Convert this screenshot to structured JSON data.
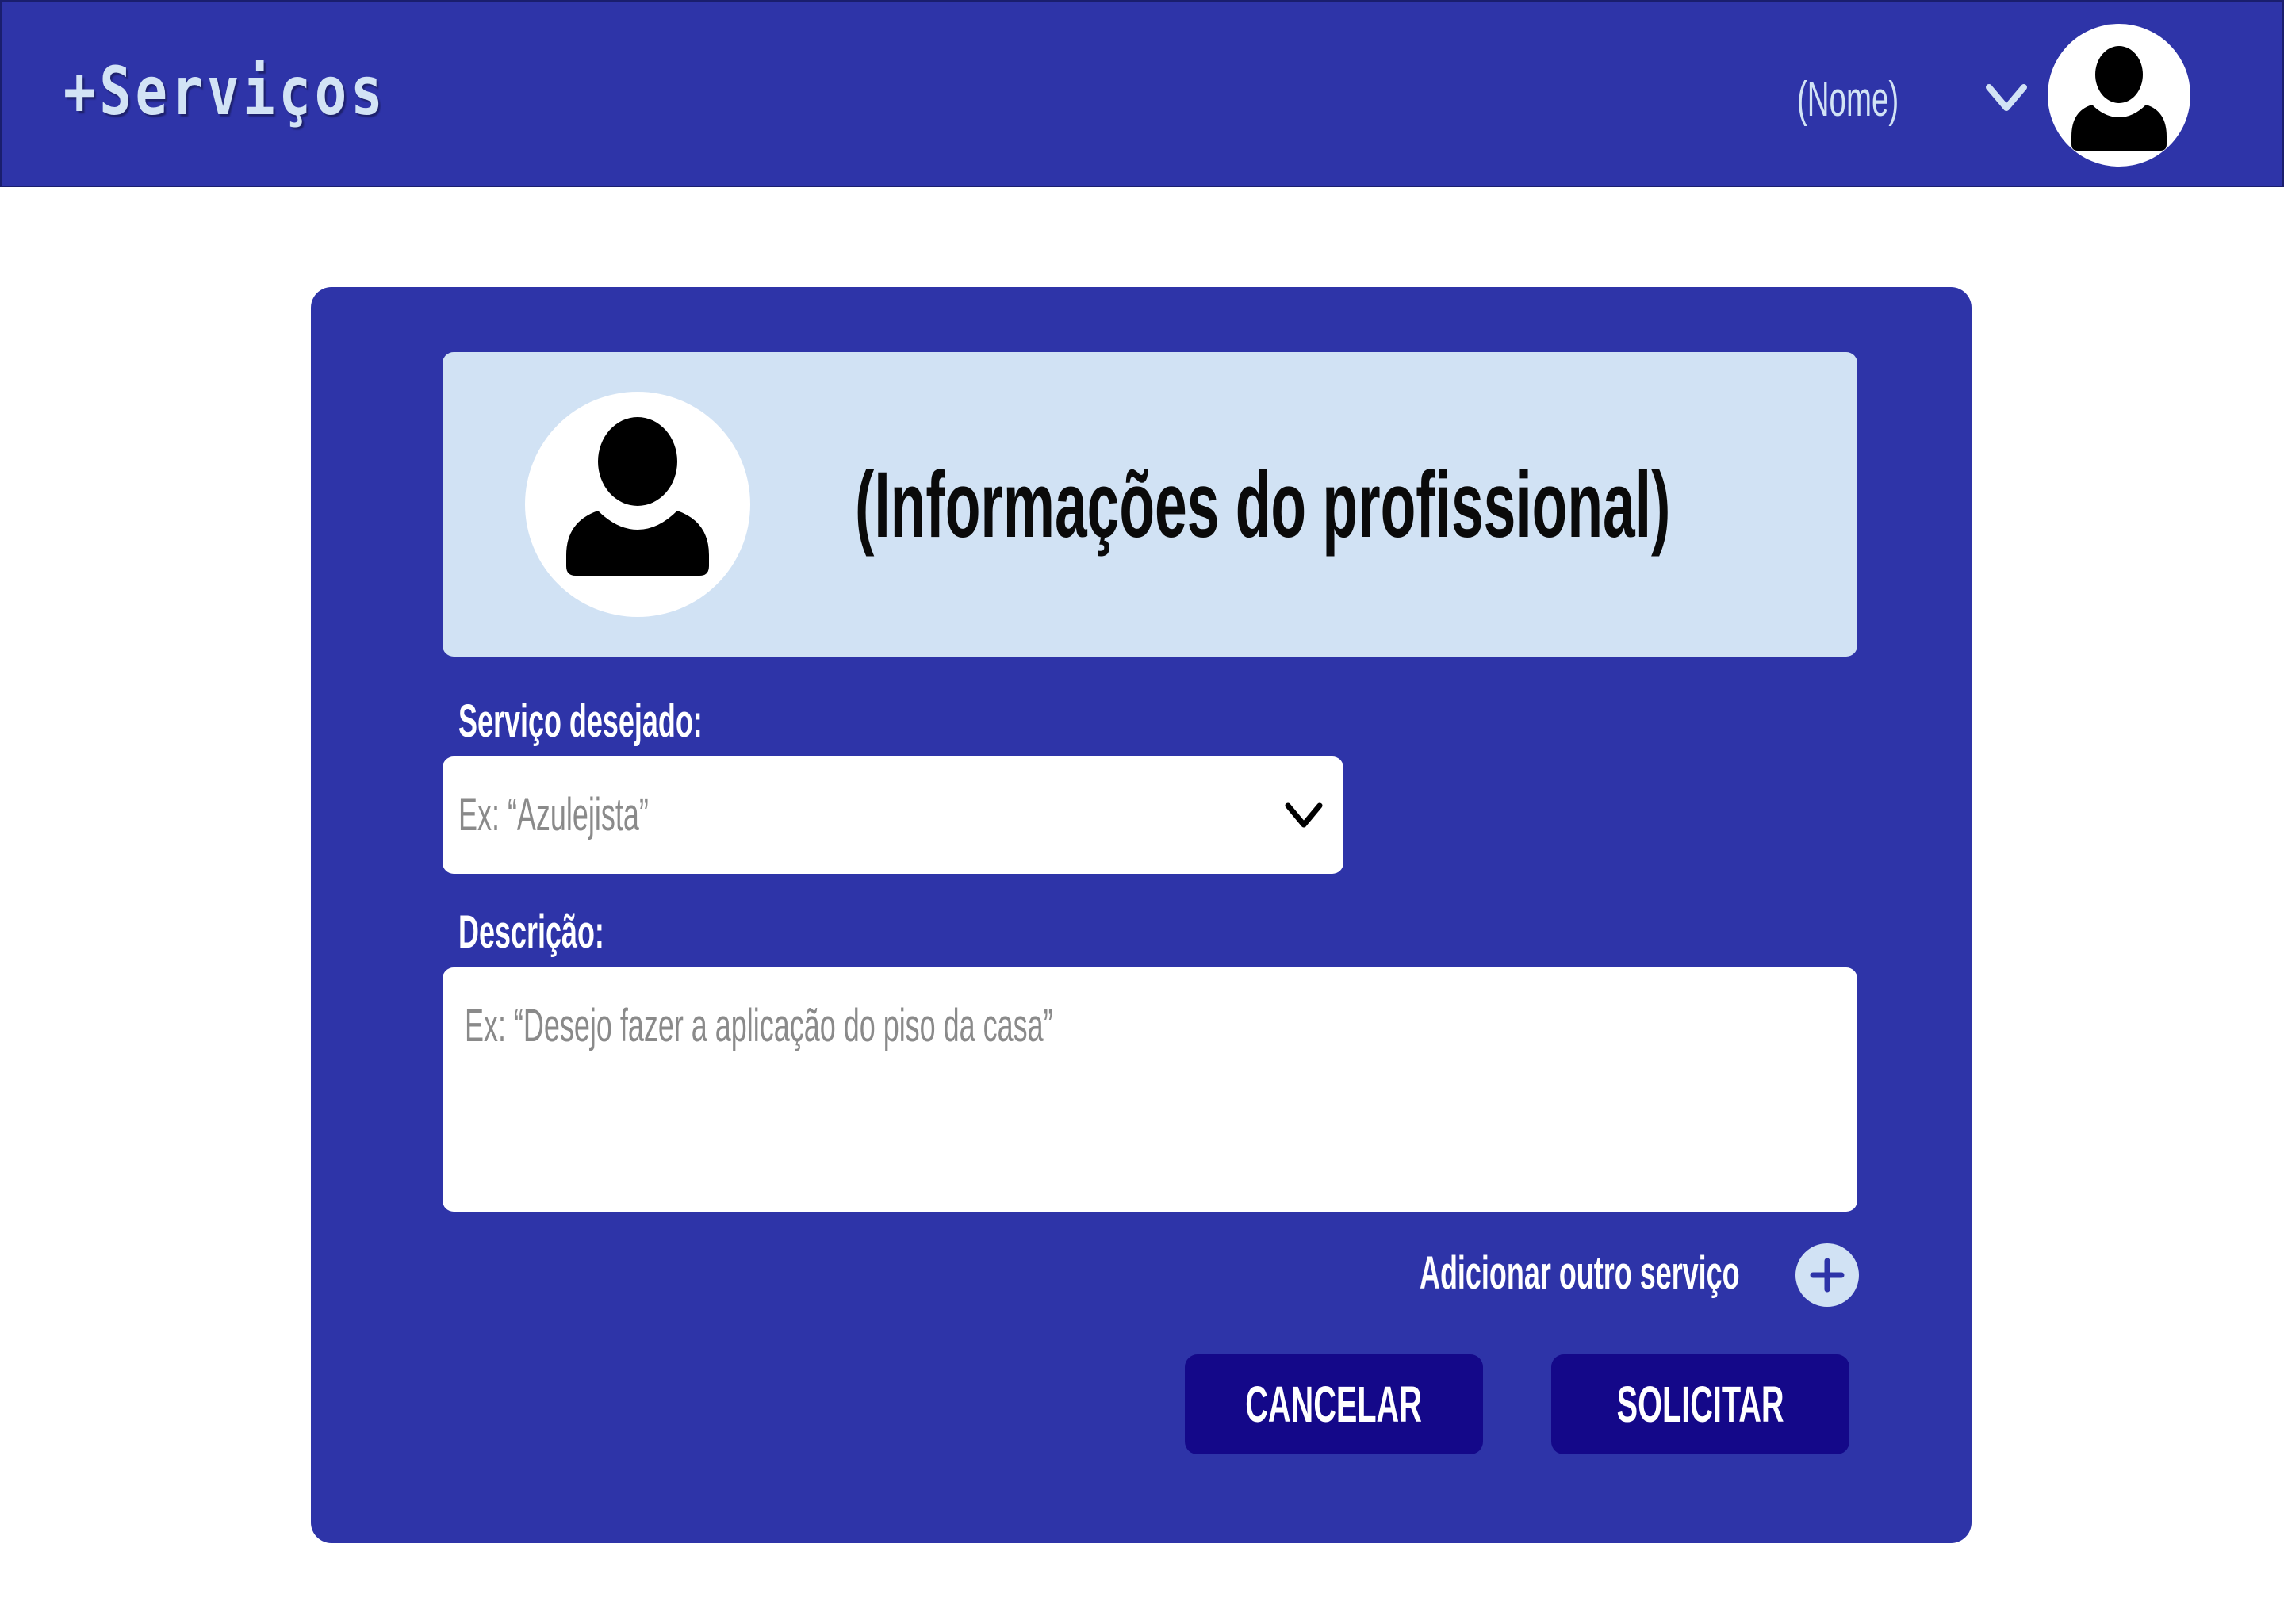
{
  "header": {
    "logo": "+Serviços",
    "user_name": "(Nome)",
    "user_menu_icon": "chevron-down-icon",
    "avatar_icon": "user-icon"
  },
  "professional": {
    "avatar_icon": "user-icon",
    "title": "(Informações do profissional)"
  },
  "form": {
    "service_label": "Serviço desejado:",
    "service_placeholder": "Ex: “Azulejista”",
    "service_dropdown_icon": "chevron-down-icon",
    "description_label": "Descrição:",
    "description_placeholder": "Ex: “Desejo fazer a aplicação do piso da casa”",
    "add_service_label": "Adicionar outro serviço",
    "add_service_icon": "plus-icon"
  },
  "actions": {
    "cancel_label": "CANCELAR",
    "submit_label": "SOLICITAR"
  },
  "colors": {
    "primary": "#2e34a8",
    "button": "#140889",
    "panel": "#d1e2f4",
    "text_light": "#d2e3f5",
    "placeholder": "#8a8a8a"
  }
}
